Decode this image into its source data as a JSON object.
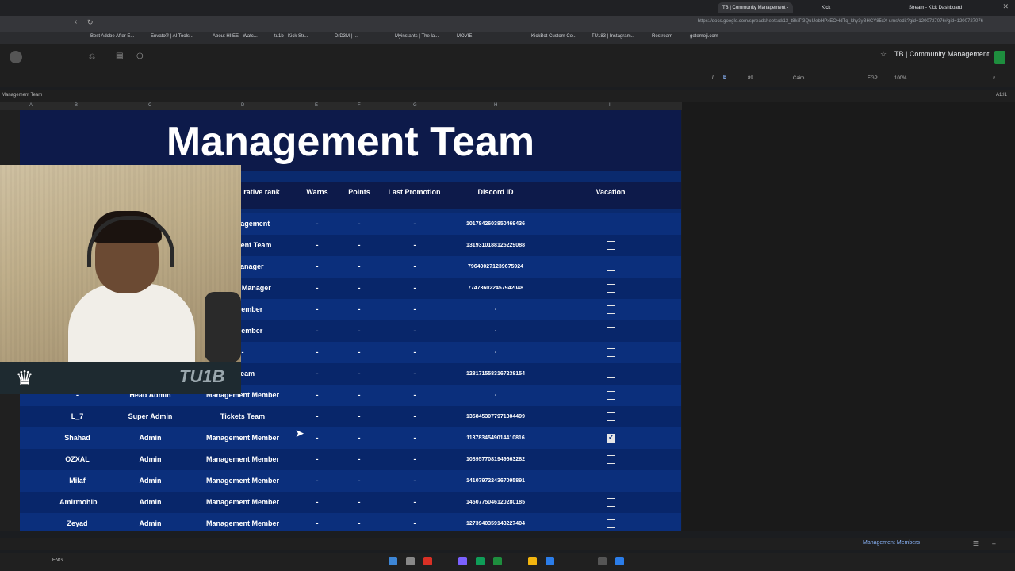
{
  "browser": {
    "tabs": [
      "TB | Community Management -",
      "Kick",
      "Stream - Kick Dashboard"
    ],
    "url": "https://docs.google.com/spreadsheets/d/13_t8kiTf3QuIJebHPxEOHdTq_khy3yBHCY85xX-ums/edit?gid=1200727076#gid=1200727076",
    "bookmarks": [
      "Best Adobe After E...",
      "Envato® | AI Tools...",
      "About HIIEE - Watc...",
      "tu1b - Kick Str...",
      "DrD3M | ...",
      "Myinstants | The la...",
      "MOVIE",
      "KickBot Custom Co...",
      "TU183 | Instagram...",
      "Restream",
      "getemoji.com"
    ]
  },
  "app": {
    "doc_title": "TB | Community Management",
    "name_box": "Management Team",
    "cell_ref": "A1:I1",
    "font": "Cairo",
    "font_size": "89",
    "zoom": "100%",
    "currency": "EGP"
  },
  "columns": [
    "A",
    "B",
    "C",
    "D",
    "E",
    "F",
    "G",
    "H",
    "I"
  ],
  "sheet": {
    "title": "Management Team",
    "headers": {
      "rank": "rative rank",
      "warns": "Warns",
      "points": "Points",
      "last_promotion": "Last Promotion",
      "discord_id": "Discord ID",
      "vacation": "Vacation"
    },
    "rows": [
      {
        "name": "",
        "admin_rank": "",
        "team": "gh Management",
        "warns": "-",
        "points": "-",
        "promo": "-",
        "discord": "1017842603850469436",
        "vacation": false
      },
      {
        "name": "",
        "admin_rank": "",
        "team": "anagement Team",
        "warns": "-",
        "points": "-",
        "promo": "-",
        "discord": "1319310188125229088",
        "vacation": false
      },
      {
        "name": "",
        "admin_rank": "",
        "team": "ent Manager",
        "warns": "-",
        "points": "-",
        "promo": "-",
        "discord": "796400271239675924",
        "vacation": false
      },
      {
        "name": "",
        "admin_rank": "",
        "team": "gement Manager",
        "warns": "-",
        "points": "-",
        "promo": "-",
        "discord": "774736022457942048",
        "vacation": false
      },
      {
        "name": "",
        "admin_rank": "",
        "team": "ent Member",
        "warns": "-",
        "points": "-",
        "promo": "-",
        "discord": "-",
        "vacation": false
      },
      {
        "name": "",
        "admin_rank": "",
        "team": "ent Member",
        "warns": "-",
        "points": "-",
        "promo": "-",
        "discord": "-",
        "vacation": false
      },
      {
        "name": "",
        "admin_rank": "",
        "team": "-",
        "warns": "-",
        "points": "-",
        "promo": "-",
        "discord": "-",
        "vacation": false
      },
      {
        "name": "",
        "admin_rank": "",
        "team": "s Team",
        "warns": "-",
        "points": "-",
        "promo": "-",
        "discord": "1281715583167238154",
        "vacation": false
      },
      {
        "name": "-",
        "admin_rank": "Head Admin",
        "team": "Management Member",
        "warns": "-",
        "points": "-",
        "promo": "-",
        "discord": "-",
        "vacation": false
      },
      {
        "name": "L_7",
        "admin_rank": "Super Admin",
        "team": "Tickets Team",
        "warns": "-",
        "points": "-",
        "promo": "-",
        "discord": "1358453077971304499",
        "vacation": false
      },
      {
        "name": "Shahad",
        "admin_rank": "Admin",
        "team": "Management Member",
        "warns": "-",
        "points": "-",
        "promo": "-",
        "discord": "1137834549014410816",
        "vacation": true
      },
      {
        "name": "OZXAL",
        "admin_rank": "Admin",
        "team": "Management Member",
        "warns": "-",
        "points": "-",
        "promo": "-",
        "discord": "1089577081949663282",
        "vacation": false
      },
      {
        "name": "Milaf",
        "admin_rank": "Admin",
        "team": "Management Member",
        "warns": "-",
        "points": "-",
        "promo": "-",
        "discord": "1410797224367095891",
        "vacation": false
      },
      {
        "name": "Amirmohib",
        "admin_rank": "Admin",
        "team": "Management Member",
        "warns": "-",
        "points": "-",
        "promo": "-",
        "discord": "1450775046120280185",
        "vacation": false
      },
      {
        "name": "Zeyad",
        "admin_rank": "Admin",
        "team": "Management Member",
        "warns": "-",
        "points": "-",
        "promo": "-",
        "discord": "1273940359143227404",
        "vacation": false
      }
    ]
  },
  "webcam": {
    "brand_text": "TU1B",
    "brand_icon": "crown-logo-icon"
  },
  "sheet_tab": "Management Members",
  "taskbar": {
    "lang": "ENG"
  },
  "colors": {
    "header_band": "#0d1a4a",
    "row_a": "#0b2f7c",
    "row_b": "#08266a"
  }
}
